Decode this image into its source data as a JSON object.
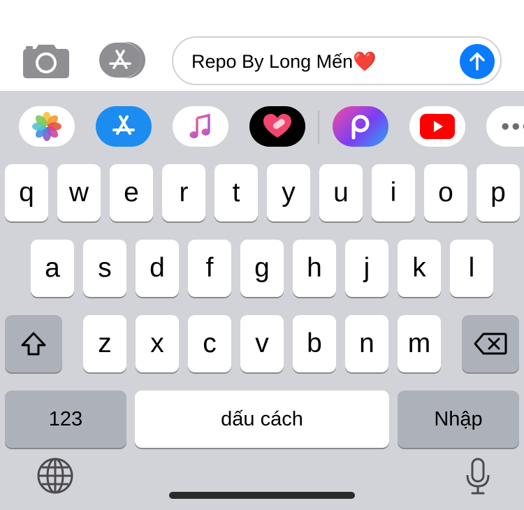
{
  "compose": {
    "message_text": "Repo By Long Mến❤️"
  },
  "keyboard": {
    "row1": [
      "q",
      "w",
      "e",
      "r",
      "t",
      "y",
      "u",
      "i",
      "o",
      "p"
    ],
    "row2": [
      "a",
      "s",
      "d",
      "f",
      "g",
      "h",
      "j",
      "k",
      "l"
    ],
    "row3": [
      "z",
      "x",
      "c",
      "v",
      "b",
      "n",
      "m"
    ],
    "numbers_label": "123",
    "space_label": "dấu cách",
    "return_label": "Nhập"
  },
  "app_strip": {
    "apps": [
      "photos-icon",
      "app-store-icon",
      "music-icon",
      "heart-sticker-icon",
      "picsart-icon",
      "youtube-icon",
      "more-icon"
    ]
  },
  "colors": {
    "send_button": "#0a7aff",
    "keyboard_bg": "#d1d3d9",
    "dark_key": "#acb1ba",
    "youtube_red": "#ff0000"
  }
}
